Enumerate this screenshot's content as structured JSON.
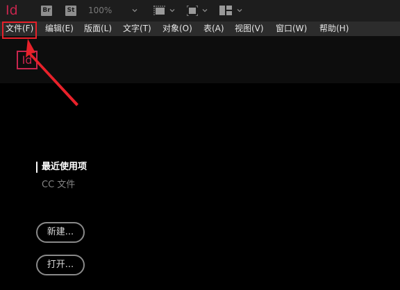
{
  "appbar": {
    "logo": "Id",
    "bridge_badge": "Br",
    "stock_badge": "St",
    "zoom": "100%",
    "icons": [
      "chevron-down-icon",
      "frame-view-icon",
      "screen-mode-icon",
      "workspace-layout-icon"
    ]
  },
  "menu": {
    "items": [
      {
        "label": "文件(F)"
      },
      {
        "label": "编辑(E)"
      },
      {
        "label": "版面(L)"
      },
      {
        "label": "文字(T)"
      },
      {
        "label": "对象(O)"
      },
      {
        "label": "表(A)"
      },
      {
        "label": "视图(V)"
      },
      {
        "label": "窗口(W)"
      },
      {
        "label": "帮助(H)"
      }
    ]
  },
  "home": {
    "logo": "Id",
    "recent_label": "最近使用项",
    "cc_files_label": "CC 文件",
    "new_button": "新建...",
    "open_button": "打开..."
  },
  "colors": {
    "brand": "#c8264e",
    "annotation": "#e8212a",
    "background": "#000000",
    "menubar": "#2c2c2c"
  }
}
